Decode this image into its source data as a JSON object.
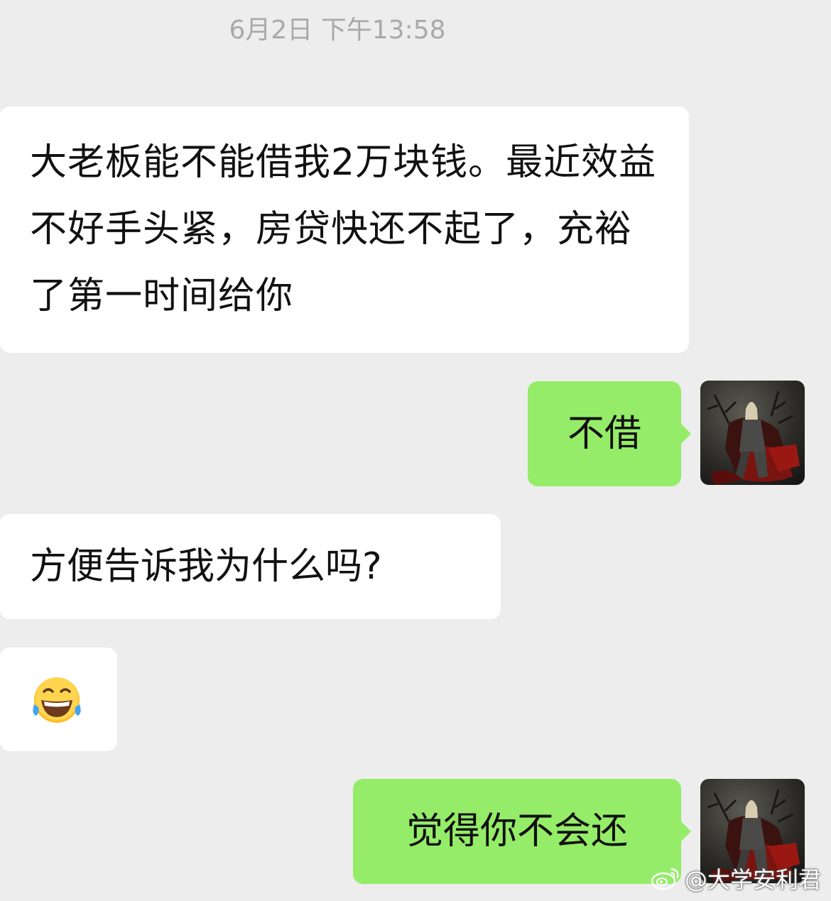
{
  "timestamp": "6月2日 下午13:58",
  "messages": [
    {
      "side": "incoming",
      "text": "大老板能不能借我2万块钱。最近效益不好手头紧，房贷快还不起了，充裕了第一时间给你"
    },
    {
      "side": "outgoing",
      "text": "不借"
    },
    {
      "side": "incoming",
      "text": "方便告诉我为什么吗?"
    },
    {
      "side": "incoming",
      "emoji": "face-with-tears-of-joy-icon"
    },
    {
      "side": "outgoing",
      "text": "觉得你不会还"
    }
  ],
  "watermark": "@大学安利君",
  "colors": {
    "background": "#ededed",
    "incoming_bubble": "#ffffff",
    "outgoing_bubble": "#95ec69",
    "timestamp_text": "#a9a9a9"
  }
}
